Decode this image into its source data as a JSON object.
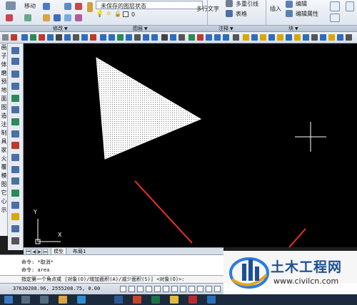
{
  "ribbon": {
    "modify_label": "移动",
    "layer_state": "未保存的图层状态",
    "layer_current": "0",
    "multiline_text": "多行文字",
    "multi_leader": "多重引线",
    "table": "表格",
    "insert": "插入",
    "edit": "编辑",
    "edit_attr": "编辑属性"
  },
  "sections": {
    "modify": "修改",
    "layers": "图层",
    "annotation": "注释",
    "block": "块"
  },
  "palette": [
    "画",
    "子",
    "体",
    "磨",
    "预",
    "地",
    "面",
    "图",
    "造",
    "注",
    "制",
    "具",
    "家",
    "火",
    "覆",
    "模",
    "图",
    "它",
    "心",
    "示"
  ],
  "canvas": {
    "ucs_x": "X",
    "ucs_y": "Y"
  },
  "tabs": {
    "model": "模型",
    "layout1": "布局1"
  },
  "command": {
    "line1": "命令: *取消*",
    "line2": "命令: area",
    "prompt": "指定第一个角点或 [对象(O)/增加面积(A)/减少面积(S)] <对象(O)>:"
  },
  "status": {
    "coords": "37630208.96, 2555208.75, 0.00"
  },
  "watermark": {
    "title": "土木工程网",
    "url": "www.civilcn.com"
  },
  "colors": {
    "canvas_bg": "#000000",
    "arrow": "#e8312a",
    "brand_blue": "#1d4f93"
  }
}
